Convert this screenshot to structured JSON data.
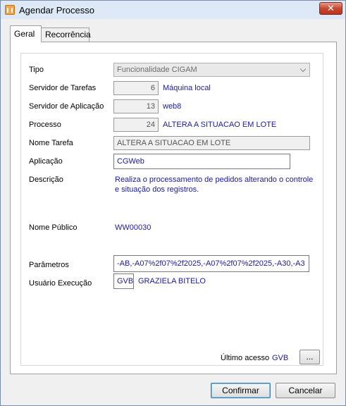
{
  "window": {
    "title": "Agendar Processo",
    "close_label": "✕"
  },
  "tabs": [
    {
      "label": "Geral",
      "active": true
    },
    {
      "label": "Recorrência",
      "active": false
    }
  ],
  "form": {
    "tipo": {
      "label": "Tipo",
      "value": "Funcionalidade CIGAM"
    },
    "servidor_tarefas": {
      "label": "Servidor de Tarefas",
      "value": "6",
      "desc": "Máquina local"
    },
    "servidor_aplicacao": {
      "label": "Servidor de Aplicação",
      "value": "13",
      "desc": "web8"
    },
    "processo": {
      "label": "Processo",
      "value": "24",
      "desc": "ALTERA A SITUACAO EM LOTE"
    },
    "nome_tarefa": {
      "label": "Nome Tarefa",
      "value": "ALTERA A SITUACAO EM LOTE"
    },
    "aplicacao": {
      "label": "Aplicação",
      "value": "CGWeb"
    },
    "descricao": {
      "label": "Descrição",
      "line1": "Realiza o processamento de pedidos alterando o controle",
      "line2": "e situação dos registros."
    },
    "nome_publico": {
      "label": "Nome Público",
      "value": "WW00030"
    },
    "parametros": {
      "label": "Parâmetros",
      "value": "-AB,-A07%2f07%2f2025,-A07%2f07%2f2025,-A30,-A3"
    },
    "usuario_execucao": {
      "label": "Usuário Execução",
      "code": "GVB",
      "name": "GRAZIELA BITELO"
    },
    "ultimo_acesso": {
      "label": "Último acesso",
      "value": "GVB",
      "button": "..."
    }
  },
  "buttons": {
    "confirmar": "Confirmar",
    "cancelar": "Cancelar"
  },
  "colors": {
    "value_text": "#1a1a9e",
    "title_bar": "#dde9f7",
    "close_button": "#c8472f"
  }
}
